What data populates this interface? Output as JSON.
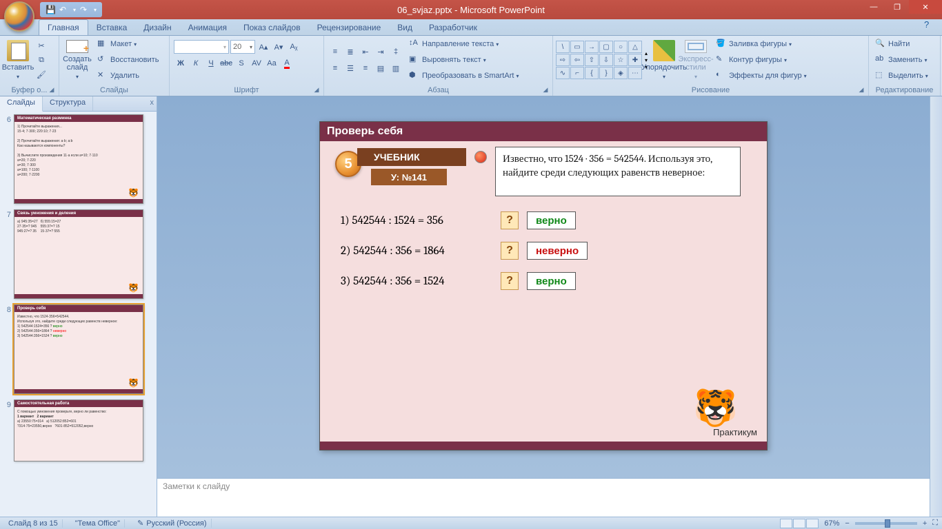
{
  "titlebar": {
    "title": "06_svjaz.pptx - Microsoft PowerPoint"
  },
  "qat": {
    "save": "💾",
    "undo": "↶",
    "redo": "↷",
    "dd": "▾"
  },
  "win": {
    "min": "—",
    "max": "❐",
    "close": "✕"
  },
  "help_icon": "?",
  "tabs": {
    "home": "Главная",
    "insert": "Вставка",
    "design": "Дизайн",
    "anim": "Анимация",
    "show": "Показ слайдов",
    "review": "Рецензирование",
    "view": "Вид",
    "dev": "Разработчик"
  },
  "ribbon": {
    "clipboard": {
      "paste": "Вставить",
      "label": "Буфер о...",
      "dd": "▾"
    },
    "slides": {
      "new": "Создать\nслайд",
      "layout": "Макет",
      "reset": "Восстановить",
      "delete": "Удалить",
      "label": "Слайды",
      "dd": "▾"
    },
    "font": {
      "size": "20",
      "label": "Шрифт",
      "dd": "▾",
      "bold": "Ж",
      "italic": "К",
      "underline": "Ч",
      "strike": "abc",
      "shadow": "S",
      "spacing": "AV",
      "case": "Aa",
      "color": "A",
      "grow": "A▴",
      "shrink": "A▾",
      "clear": "Aᵪ"
    },
    "paragraph": {
      "label": "Абзац",
      "textdir": "Направление текста",
      "align": "Выровнять текст",
      "smartart": "Преобразовать в SmartArt",
      "dd": "▾"
    },
    "drawing": {
      "arrange": "Упорядочить",
      "styles": "Экспресс-стили",
      "fill": "Заливка фигуры",
      "outline": "Контур фигуры",
      "effects": "Эффекты для фигур",
      "label": "Рисование",
      "dd": "▾"
    },
    "editing": {
      "find": "Найти",
      "replace": "Заменить",
      "select": "Выделить",
      "label": "Редактирование",
      "dd": "▾"
    }
  },
  "panel": {
    "slides": "Слайды",
    "outline": "Структура",
    "close": "x"
  },
  "thumbs": {
    "t6": {
      "num": "6",
      "title": "Математическая разминка"
    },
    "t7": {
      "num": "7",
      "title": "Связь умножения и деления"
    },
    "t8": {
      "num": "8",
      "title": "Проверь себя"
    },
    "t9": {
      "num": "9",
      "title": "Самостоятельная работа"
    }
  },
  "slide": {
    "title": "Проверь себя",
    "badge": "5",
    "textbook": "УЧЕБНИК",
    "ref": "У: №141",
    "task": "Известно, что 1524 · 356 = 542544. Используя это, найдите среди следующих равенств неверное:",
    "eq1": "1) 542544 : 1524 = 356",
    "eq2": "2) 542544 : 356 = 1864",
    "eq3": "3) 542544 : 356 = 1524",
    "q": "?",
    "ans_correct": "верно",
    "ans_wrong": "неверно",
    "footer": "Практикум",
    "tiger": "🐯"
  },
  "notes": {
    "placeholder": "Заметки к слайду"
  },
  "status": {
    "slide": "Слайд 8 из 15",
    "theme": "\"Тема Office\"",
    "lang": "Русский (Россия)",
    "zoom": "67%",
    "fit": "⛶"
  }
}
